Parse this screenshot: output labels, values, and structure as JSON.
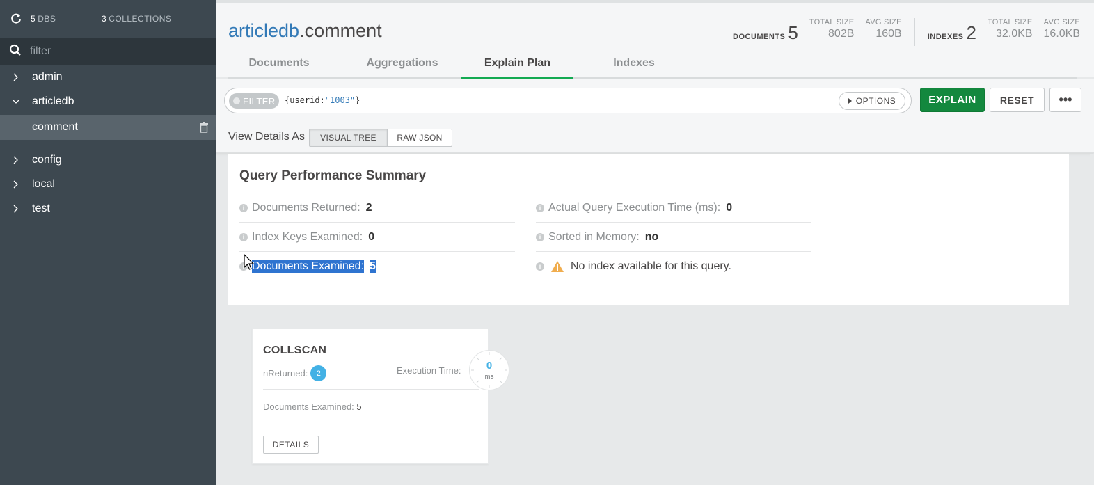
{
  "sidebar": {
    "dbs_count": "5",
    "dbs_label": "DBS",
    "collections_count": "3",
    "collections_label": "COLLECTIONS",
    "filter_placeholder": "filter",
    "databases": [
      {
        "label": "admin",
        "expanded": false
      },
      {
        "label": "articledb",
        "expanded": true,
        "collections": [
          {
            "label": "comment",
            "selected": true
          }
        ]
      },
      {
        "label": "config",
        "expanded": false
      },
      {
        "label": "local",
        "expanded": false
      },
      {
        "label": "test",
        "expanded": false
      }
    ]
  },
  "header": {
    "db": "articledb",
    "collection": ".comment",
    "documents_label": "DOCUMENTS",
    "documents_count": "5",
    "doc_total_size_label": "TOTAL SIZE",
    "doc_total_size": "802B",
    "doc_avg_size_label": "AVG SIZE",
    "doc_avg_size": "160B",
    "indexes_label": "INDEXES",
    "indexes_count": "2",
    "idx_total_size_label": "TOTAL SIZE",
    "idx_total_size": "32.0KB",
    "idx_avg_size_label": "AVG SIZE",
    "idx_avg_size": "16.0KB"
  },
  "tabs": [
    {
      "label": "Documents",
      "active": false
    },
    {
      "label": "Aggregations",
      "active": false
    },
    {
      "label": "Explain Plan",
      "active": true
    },
    {
      "label": "Indexes",
      "active": false
    }
  ],
  "query": {
    "filter_label": "FILTER",
    "filter_open": "{userid:",
    "filter_value": "\"1003\"",
    "filter_close": "}",
    "options_label": "OPTIONS",
    "explain_label": "EXPLAIN",
    "reset_label": "RESET",
    "more_label": "•••"
  },
  "view_details": {
    "label": "View Details As",
    "visual_tree": "VISUAL TREE",
    "raw_json": "RAW JSON",
    "selected": "VISUAL TREE"
  },
  "summary": {
    "title": "Query Performance Summary",
    "docs_returned_label": "Documents Returned:",
    "docs_returned": "2",
    "index_keys_label": "Index Keys Examined:",
    "index_keys": "0",
    "docs_examined_label": "Documents Examined:",
    "docs_examined": "5",
    "exec_time_label": "Actual Query Execution Time (ms):",
    "exec_time": "0",
    "sorted_label": "Sorted in Memory:",
    "sorted": "no",
    "warning": "No index available for this query."
  },
  "stage": {
    "name": "COLLSCAN",
    "nreturned_label": "nReturned:",
    "nreturned": "2",
    "exec_label": "Execution Time:",
    "exec_value": "0",
    "exec_unit": "ms",
    "docs_examined_label": "Documents Examined:",
    "docs_examined": "5",
    "details_label": "DETAILS"
  },
  "colors": {
    "sidebar_bg": "#3d4850",
    "accent_green": "#13aa52",
    "explain_button": "#13883e",
    "link_blue": "#337ab7",
    "badge_blue": "#43b1e5",
    "selection": "#2f74d0"
  }
}
